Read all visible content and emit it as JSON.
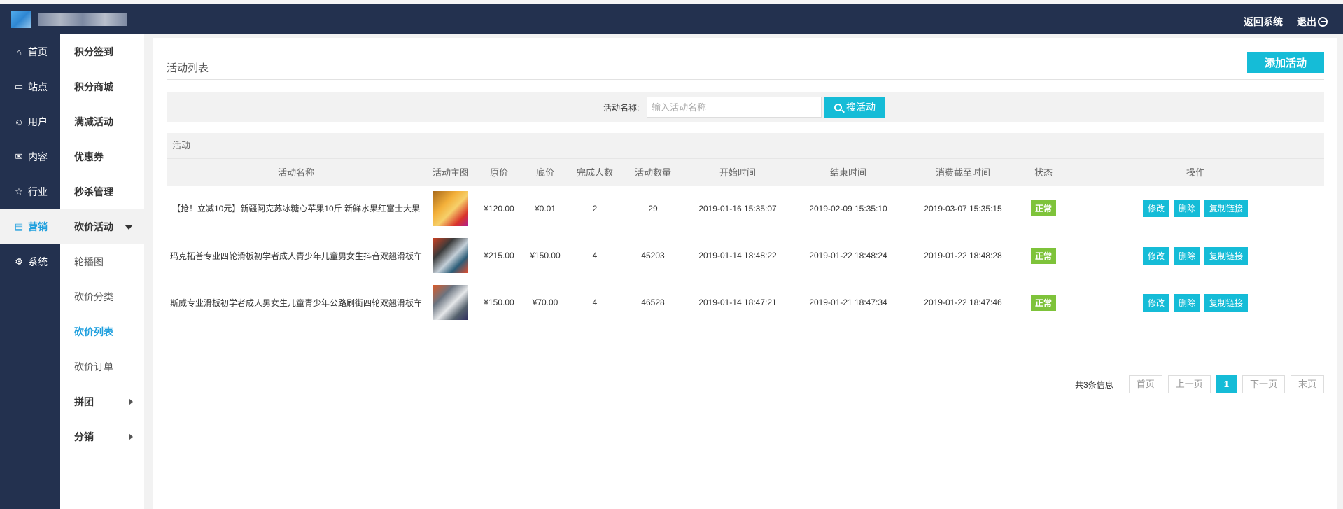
{
  "topbar": {
    "back_label": "返回系统",
    "logout_label": "退出"
  },
  "nav_primary": [
    {
      "label": "首页",
      "icon": "home-icon",
      "glyph": "⌂"
    },
    {
      "label": "站点",
      "icon": "monitor-icon",
      "glyph": "▭"
    },
    {
      "label": "用户",
      "icon": "user-icon",
      "glyph": "☺"
    },
    {
      "label": "内容",
      "icon": "inbox-icon",
      "glyph": "✉"
    },
    {
      "label": "行业",
      "icon": "star-icon",
      "glyph": "☆"
    },
    {
      "label": "营销",
      "icon": "wallet-icon",
      "glyph": "▤"
    },
    {
      "label": "系统",
      "icon": "gear-icon",
      "glyph": "⚙"
    }
  ],
  "nav_secondary": [
    {
      "label": "积分签到"
    },
    {
      "label": "积分商城"
    },
    {
      "label": "满减活动"
    },
    {
      "label": "优惠券"
    },
    {
      "label": "秒杀管理"
    },
    {
      "label": "砍价活动"
    },
    {
      "label": "轮播图"
    },
    {
      "label": "砍价分类"
    },
    {
      "label": "砍价列表"
    },
    {
      "label": "砍价订单"
    },
    {
      "label": "拼团"
    },
    {
      "label": "分销"
    }
  ],
  "panel": {
    "title": "活动列表",
    "add_label": "添加活动"
  },
  "search": {
    "label": "活动名称:",
    "placeholder": "输入活动名称",
    "button_label": "搜活动"
  },
  "table": {
    "caption": "活动",
    "headers": [
      "活动名称",
      "活动主图",
      "原价",
      "底价",
      "完成人数",
      "活动数量",
      "开始时间",
      "结束时间",
      "消费截至时间",
      "状态",
      "操作"
    ],
    "rows": [
      {
        "name": "【抢！立减10元】新疆阿克苏冰糖心苹果10斤 新鲜水果红富士大果",
        "price": "¥120.00",
        "floor": "¥0.01",
        "done": "2",
        "qty": "29",
        "start": "2019-01-16 15:35:07",
        "end": "2019-02-09 15:35:10",
        "deadline": "2019-03-07 15:35:15",
        "status": "正常"
      },
      {
        "name": "玛克拓普专业四轮滑板初学者成人青少年儿童男女生抖音双翘滑板车",
        "price": "¥215.00",
        "floor": "¥150.00",
        "done": "4",
        "qty": "45203",
        "start": "2019-01-14 18:48:22",
        "end": "2019-01-22 18:48:24",
        "deadline": "2019-01-22 18:48:28",
        "status": "正常"
      },
      {
        "name": "斯威专业滑板初学者成人男女生儿童青少年公路刷街四轮双翘滑板车",
        "price": "¥150.00",
        "floor": "¥70.00",
        "done": "4",
        "qty": "46528",
        "start": "2019-01-14 18:47:21",
        "end": "2019-01-21 18:47:34",
        "deadline": "2019-01-22 18:47:46",
        "status": "正常"
      }
    ],
    "actions": {
      "edit": "修改",
      "delete": "删除",
      "copy": "复制链接"
    }
  },
  "pagination": {
    "info": "共3条信息",
    "first": "首页",
    "prev": "上一页",
    "current": "1",
    "next": "下一页",
    "last": "末页"
  }
}
